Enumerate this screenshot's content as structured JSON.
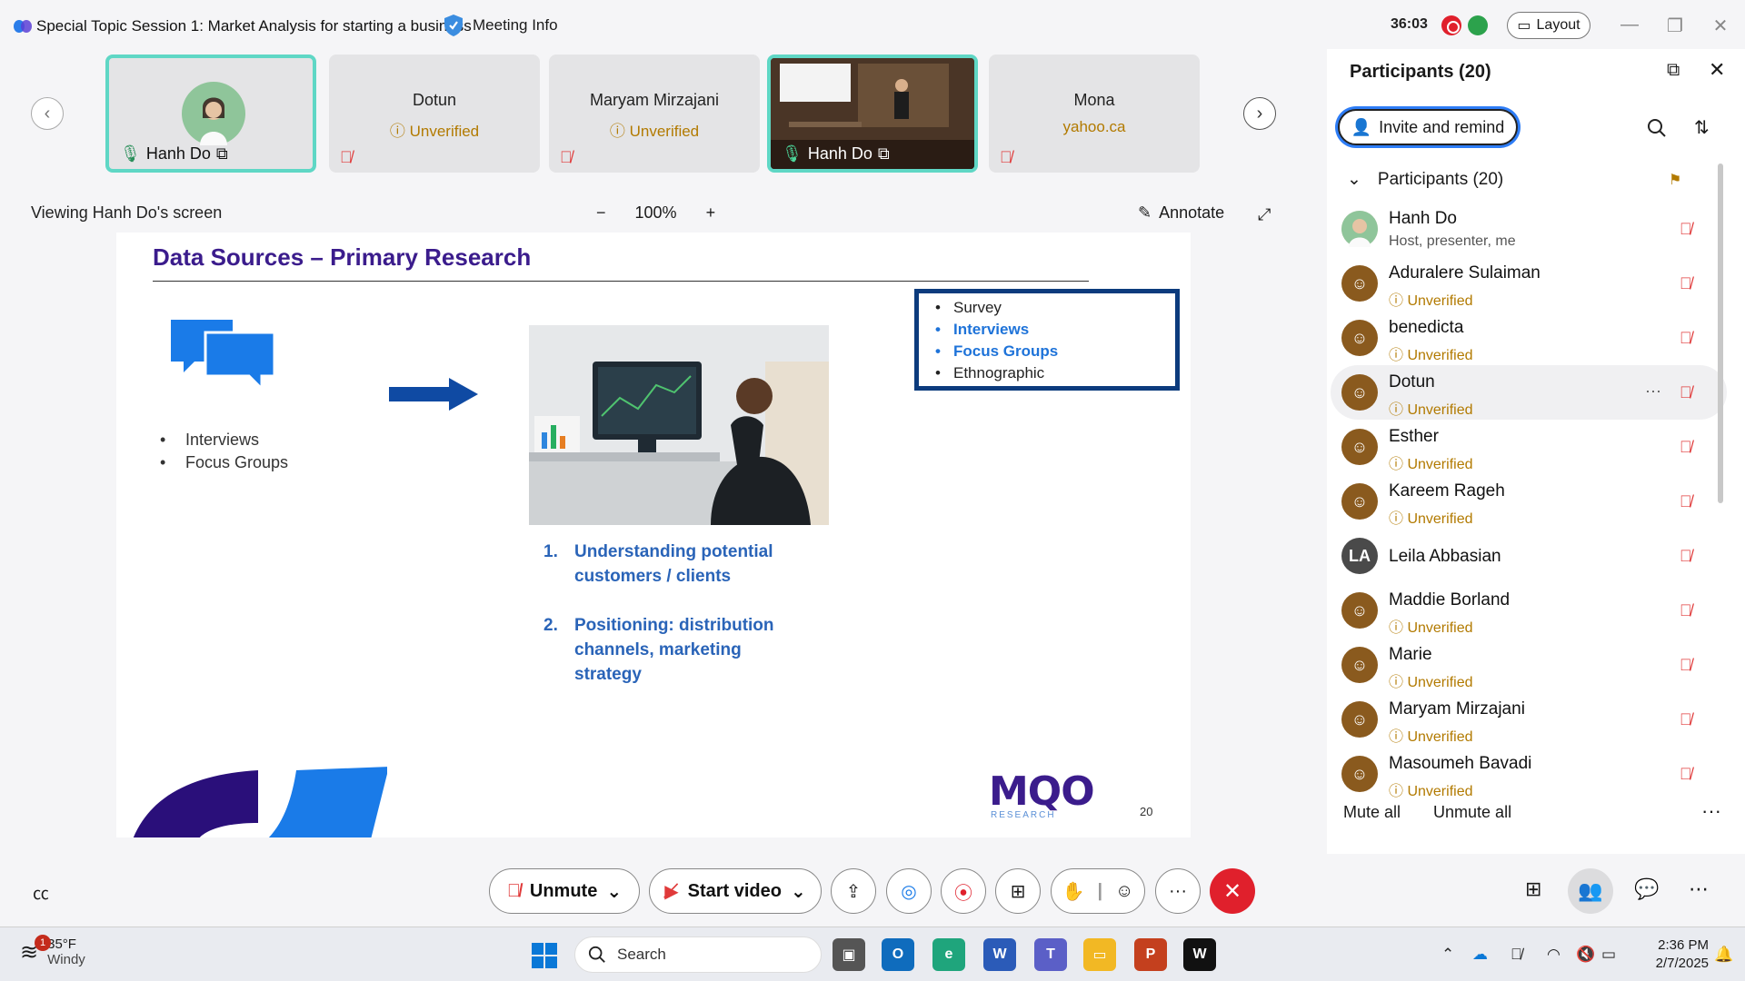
{
  "window": {
    "title": "Special Topic Session 1: Market Analysis for starting a business",
    "meeting_info": "Meeting Info",
    "timer": "36:03",
    "layout_label": "Layout",
    "controls": {
      "minimize": "—",
      "restore": "❐",
      "close": "✕"
    }
  },
  "video_tiles": [
    {
      "name": "Hanh Do",
      "status": "",
      "type": "avatar"
    },
    {
      "name": "Dotun",
      "status": "Unverified",
      "type": "name"
    },
    {
      "name": "Maryam Mirzajani",
      "status": "Unverified",
      "type": "name"
    },
    {
      "name": "Hanh Do",
      "status": "",
      "type": "video"
    },
    {
      "name": "Mona",
      "status": "yahoo.ca",
      "type": "name"
    }
  ],
  "stage": {
    "viewing": "Viewing Hanh Do's screen",
    "zoom_out": "−",
    "zoom_level": "100%",
    "zoom_in": "+",
    "annotate": "Annotate"
  },
  "slide": {
    "title": "Data Sources – Primary Research",
    "left_bullets": [
      "Interviews",
      "Focus Groups"
    ],
    "numbered": [
      {
        "n": "1.",
        "text": "Understanding potential customers / clients"
      },
      {
        "n": "2.",
        "text": "Positioning: distribution channels, marketing strategy"
      }
    ],
    "box_bullets": [
      {
        "text": "Survey",
        "highlight": false
      },
      {
        "text": "Interviews",
        "highlight": true
      },
      {
        "text": "Focus Groups",
        "highlight": true
      },
      {
        "text": "Ethnographic",
        "highlight": false
      }
    ],
    "logo": "MQO",
    "logo_sub": "RESEARCH",
    "page_number": "20"
  },
  "participants_panel": {
    "title": "Participants (20)",
    "invite_label": "Invite and remind",
    "group_label": "Participants (20)",
    "mute_all": "Mute all",
    "unmute_all": "Unmute all",
    "more": "···",
    "row_more": "···",
    "people": [
      {
        "name": "Hanh Do",
        "sub": "Host, presenter, me",
        "avatar": "host"
      },
      {
        "name": "Aduralere Sulaiman",
        "sub": "Unverified",
        "avatar": "generic"
      },
      {
        "name": "benedicta",
        "sub": "Unverified",
        "avatar": "generic"
      },
      {
        "name": "Dotun",
        "sub": "Unverified",
        "avatar": "generic"
      },
      {
        "name": "Esther",
        "sub": "Unverified",
        "avatar": "generic"
      },
      {
        "name": "Kareem Rageh",
        "sub": "Unverified",
        "avatar": "generic"
      },
      {
        "name": "Leila Abbasian",
        "sub": "",
        "avatar": "LA"
      },
      {
        "name": "Maddie Borland",
        "sub": "Unverified",
        "avatar": "generic"
      },
      {
        "name": "Marie",
        "sub": "Unverified",
        "avatar": "generic"
      },
      {
        "name": "Maryam Mirzajani",
        "sub": "Unverified",
        "avatar": "generic"
      },
      {
        "name": "Masoumeh Bavadi",
        "sub": "Unverified",
        "avatar": "generic"
      }
    ]
  },
  "controls": {
    "unmute": "Unmute",
    "start_video": "Start video",
    "more": "···",
    "end": "✕"
  },
  "taskbar": {
    "weather_badge": "1",
    "weather_temp": "35°F",
    "weather_desc": "Windy",
    "search_placeholder": "Search",
    "time": "2:36 PM",
    "date": "2/7/2025"
  },
  "colors": {
    "accent": "#2e7df6",
    "active_tile_border": "#5fd7c5",
    "unverified": "#b27a00",
    "muted": "#e03a3a",
    "end_call": "#e0202c",
    "slide_title": "#3b1c8c",
    "slide_highlight": "#2a64b8"
  }
}
